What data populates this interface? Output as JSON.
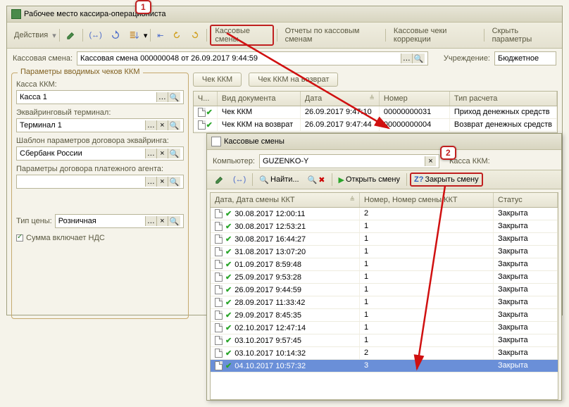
{
  "mainWindow": {
    "title": "Рабочее место кассира-операциониста",
    "toolbar": {
      "actions": "Действия",
      "links": [
        "Кассовые смены",
        "Отчеты по кассовым сменам",
        "Кассовые чеки коррекции",
        "Скрыть параметры"
      ]
    },
    "shiftRow": {
      "label": "Кассовая смена:",
      "value": "Кассовая смена 000000048 от 26.09.2017 9:44:59",
      "orgLabel": "Учреждение:",
      "orgValue": "Бюджетное"
    },
    "params": {
      "legend": "Параметры вводимых чеков ККМ",
      "kassaLabel": "Касса ККМ:",
      "kassaValue": "Касса 1",
      "termLabel": "Эквайринговый терминал:",
      "termValue": "Терминал 1",
      "templLabel": "Шаблон параметров договора эквайринга:",
      "templValue": "Сбербанк России",
      "agentLabel": "Параметры договора платежного агента:",
      "agentValue": "",
      "priceLabel": "Тип цены:",
      "priceValue": "Розничная",
      "ndsLabel": "Сумма включает НДС"
    },
    "buttons": {
      "chek": "Чек ККМ",
      "vozvrat": "Чек ККМ на возврат"
    },
    "docs": {
      "cols": [
        "Ч...",
        "Вид документа",
        "Дата",
        "Номер",
        "Тип расчета"
      ],
      "rows": [
        {
          "type": "Чек ККМ",
          "date": "26.09.2017 9:47:10",
          "num": "00000000031",
          "calc": "Приход денежных средств"
        },
        {
          "type": "Чек ККМ на возврат",
          "date": "26.09.2017 9:47:44",
          "num": "00000000004",
          "calc": "Возврат денежных средств"
        }
      ]
    }
  },
  "subWindow": {
    "title": "Кассовые смены",
    "compLabel": "Компьютер:",
    "compValue": "GUZENKO-Y",
    "kassaLabel": "Касса ККМ:",
    "toolbar": {
      "find": "Найти...",
      "open": "Открыть смену",
      "close": "Закрыть смену"
    },
    "grid": {
      "cols": [
        "Дата, Дата смены ККТ",
        "Номер, Номер смены ККТ",
        "Статус"
      ],
      "rows": [
        {
          "d": "30.08.2017 12:00:11",
          "n": "2",
          "s": "Закрыта"
        },
        {
          "d": "30.08.2017 12:53:21",
          "n": "1",
          "s": "Закрыта"
        },
        {
          "d": "30.08.2017 16:44:27",
          "n": "1",
          "s": "Закрыта"
        },
        {
          "d": "31.08.2017 13:07:20",
          "n": "1",
          "s": "Закрыта"
        },
        {
          "d": "01.09.2017 8:59:48",
          "n": "1",
          "s": "Закрыта"
        },
        {
          "d": "25.09.2017 9:53:28",
          "n": "1",
          "s": "Закрыта"
        },
        {
          "d": "26.09.2017 9:44:59",
          "n": "1",
          "s": "Закрыта"
        },
        {
          "d": "28.09.2017 11:33:42",
          "n": "1",
          "s": "Закрыта"
        },
        {
          "d": "29.09.2017 8:45:35",
          "n": "1",
          "s": "Закрыта"
        },
        {
          "d": "02.10.2017 12:47:14",
          "n": "1",
          "s": "Закрыта"
        },
        {
          "d": "03.10.2017 9:57:45",
          "n": "1",
          "s": "Закрыта"
        },
        {
          "d": "03.10.2017 10:14:32",
          "n": "2",
          "s": "Закрыта"
        },
        {
          "d": "04.10.2017 10:57:32",
          "n": "3",
          "s": "Закрыта",
          "sel": true
        }
      ]
    }
  },
  "badges": {
    "one": "1",
    "two": "2"
  }
}
